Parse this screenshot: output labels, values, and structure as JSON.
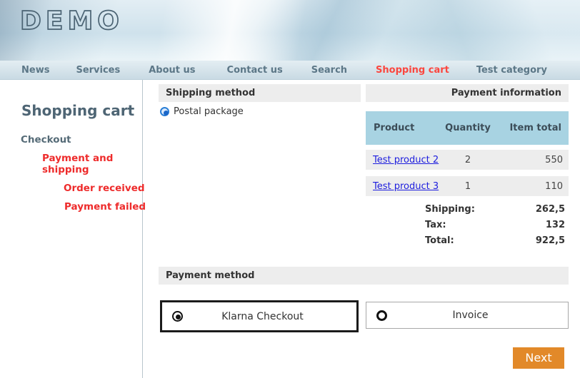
{
  "brand": {
    "logo_text": "DEMO"
  },
  "nav": {
    "items": [
      {
        "label": "News",
        "active": false
      },
      {
        "label": "Services",
        "active": false
      },
      {
        "label": "About us",
        "active": false
      },
      {
        "label": "Contact us",
        "active": false
      },
      {
        "label": "Search",
        "active": false
      },
      {
        "label": "Shopping cart",
        "active": true
      },
      {
        "label": "Test category",
        "active": false
      }
    ]
  },
  "sidebar": {
    "title": "Shopping cart",
    "items": [
      {
        "label": "Checkout",
        "level": 0,
        "highlighted": false
      },
      {
        "label": "Payment and shipping",
        "level": 1,
        "highlighted": true
      },
      {
        "label": "Order received",
        "level": 2,
        "highlighted": true
      },
      {
        "label": "Payment failed",
        "level": 2,
        "highlighted": true
      }
    ]
  },
  "shipping": {
    "section_title": "Shipping method",
    "options": [
      {
        "label": "Postal package",
        "selected": true
      }
    ]
  },
  "payment_info": {
    "section_title": "Payment information",
    "table": {
      "columns": [
        "Product",
        "Quantity",
        "Item total"
      ],
      "rows": [
        {
          "product": "Test product 2",
          "quantity": "2",
          "item_total": "550"
        },
        {
          "product": "Test product 3",
          "quantity": "1",
          "item_total": "110"
        }
      ],
      "summary": [
        {
          "label": "Shipping:",
          "value": "262,5"
        },
        {
          "label": "Tax:",
          "value": "132"
        },
        {
          "label": "Total:",
          "value": "922,5"
        }
      ]
    }
  },
  "payment_method": {
    "section_title": "Payment method",
    "options": [
      {
        "label": "Klarna Checkout",
        "selected": true
      },
      {
        "label": "Invoice",
        "selected": false
      }
    ]
  },
  "actions": {
    "next_label": "Next"
  },
  "colors": {
    "accent_red": "#ee2b2b",
    "nav_active_red": "#fb463e",
    "heading_gray_blue": "#4e6574",
    "table_header_bg": "#a8d3e2",
    "row_bg": "#ededed",
    "section_bar_bg": "#ededed",
    "link_blue": "#1d1dde",
    "radio_blue": "#2a7fd6",
    "next_button_bg": "#e28929"
  }
}
